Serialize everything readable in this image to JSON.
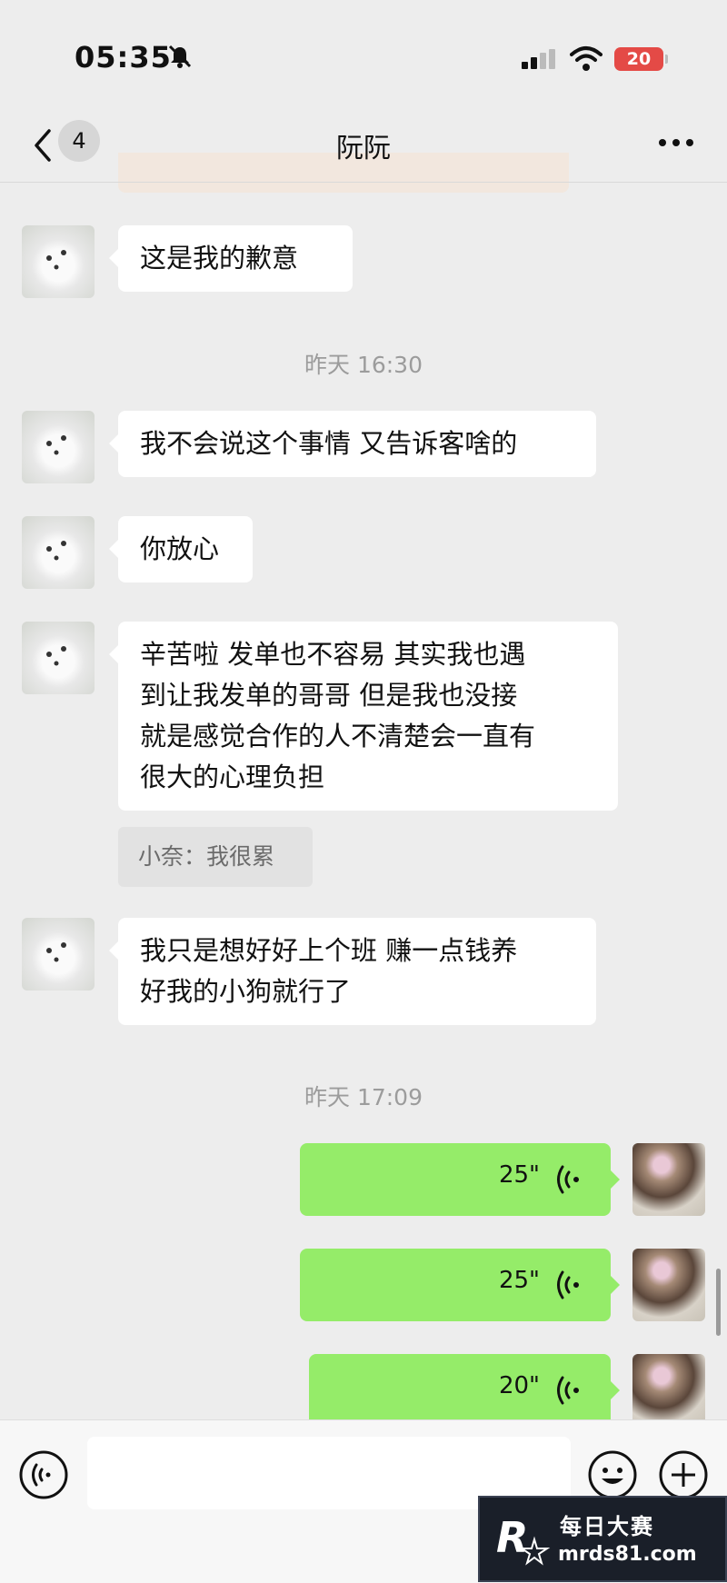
{
  "status_bar": {
    "time": "05:35",
    "battery": "20",
    "battery_color": "#e44a46"
  },
  "nav": {
    "unread_count": "4",
    "title": "阮阮"
  },
  "messages": [
    {
      "sender": "contact",
      "type": "text",
      "text": "这是我的歉意"
    },
    {
      "type": "time",
      "text": "昨天 16:30"
    },
    {
      "sender": "contact",
      "type": "text",
      "text": "我不会说这个事情 又告诉客啥的"
    },
    {
      "sender": "contact",
      "type": "text",
      "text": "你放心"
    },
    {
      "sender": "contact",
      "type": "text",
      "lines": [
        "辛苦啦 发单也不容易 其实我也遇",
        "到让我发单的哥哥 但是我也没接",
        "就是感觉合作的人不清楚会一直有",
        "很大的心理负担"
      ]
    },
    {
      "type": "quote",
      "text": "小奈：我很累"
    },
    {
      "sender": "contact",
      "type": "text",
      "lines": [
        "我只是想好好上个班 赚一点钱养",
        "好我的小狗就行了"
      ]
    },
    {
      "type": "time",
      "text": "昨天 17:09"
    },
    {
      "sender": "me",
      "type": "voice",
      "duration": "25\""
    },
    {
      "sender": "me",
      "type": "voice",
      "duration": "25\""
    },
    {
      "sender": "me",
      "type": "voice",
      "duration": "20\""
    }
  ],
  "input_bar": {
    "placeholder": ""
  },
  "watermark": {
    "title": "每日大赛",
    "site": "mrds81.com"
  },
  "colors": {
    "my_bubble": "#95ec69",
    "their_bubble": "#ffffff",
    "background": "#ededed"
  }
}
